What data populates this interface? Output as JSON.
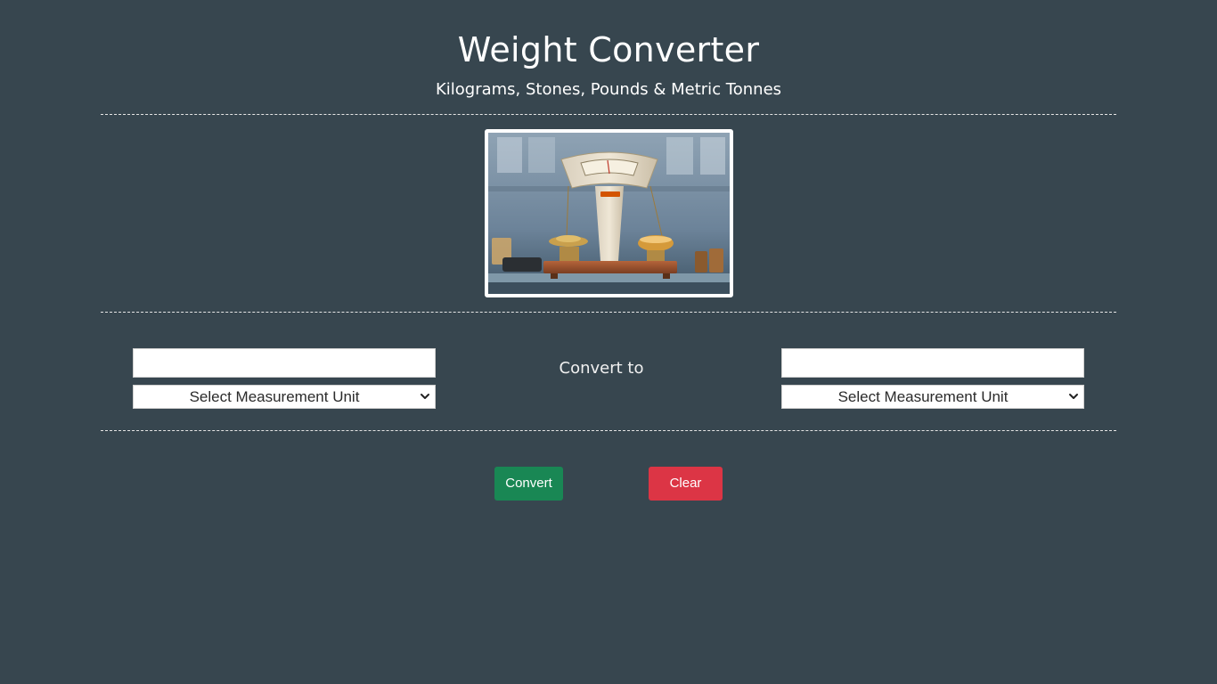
{
  "header": {
    "title": "Weight Converter",
    "subtitle": "Kilograms, Stones, Pounds & Metric Tonnes"
  },
  "hero_image": {
    "alt": "vintage weighing scale"
  },
  "converter": {
    "from_value": "",
    "to_value": "",
    "from_unit_selected": "Select Measurement Unit",
    "to_unit_selected": "Select Measurement Unit",
    "convert_to_label": "Convert to"
  },
  "buttons": {
    "convert_label": "Convert",
    "clear_label": "Clear"
  },
  "colors": {
    "background": "#37464f",
    "convert_button": "#198754",
    "clear_button": "#dc3545",
    "text": "#ffffff"
  },
  "icons": {
    "select_arrow": "chevron-down-icon"
  }
}
